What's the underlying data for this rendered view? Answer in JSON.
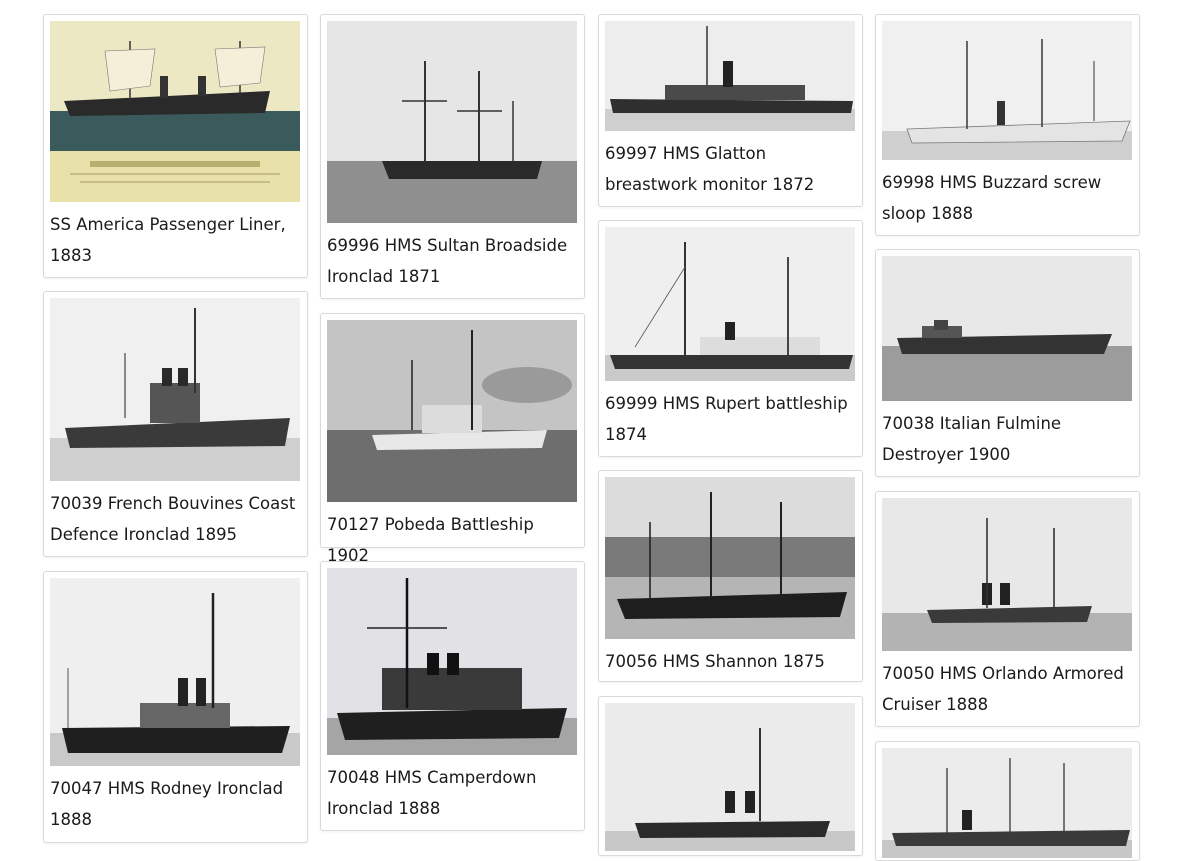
{
  "gallery": {
    "items": [
      {
        "caption": "SS America Passenger Liner, 1883"
      },
      {
        "caption": "69996 HMS Sultan Broadside Ironclad 1871"
      },
      {
        "caption": "69997 HMS Glatton breastwork monitor 1872"
      },
      {
        "caption": "69998 HMS Buzzard screw sloop 1888"
      },
      {
        "caption": "70039 French Bouvines Coast Defence Ironclad 1895"
      },
      {
        "caption": "70127 Pobeda Battleship 1902"
      },
      {
        "caption": "69999 HMS Rupert battleship 1874"
      },
      {
        "caption": "70038 Italian Fulmine Destroyer 1900"
      },
      {
        "caption": "70047 HMS Rodney Ironclad 1888"
      },
      {
        "caption": "70048 HMS Camperdown Ironclad 1888"
      },
      {
        "caption": "70056 HMS Shannon 1875"
      },
      {
        "caption": "70050 HMS Orlando Armored Cruiser 1888"
      },
      {
        "caption": ""
      },
      {
        "caption": ""
      }
    ]
  },
  "colors": {
    "card_border": "#d9d9d9",
    "caption_text": "#1a1a1a",
    "photo_sky": "#d8d8d8",
    "photo_sea": "#8a8a8a",
    "lithograph_tint": "#e6dfa6"
  }
}
